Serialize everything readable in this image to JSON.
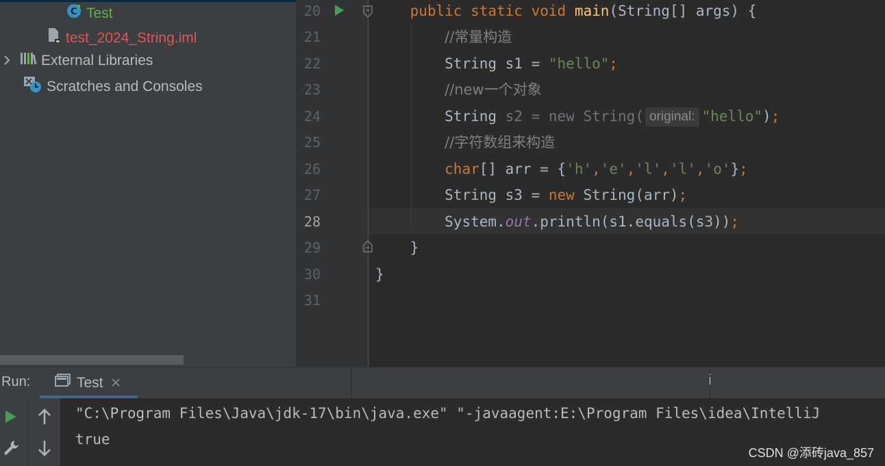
{
  "project_tree": {
    "items": [
      {
        "label": "Test",
        "icon": "java-class-icon",
        "color": "#62b543"
      },
      {
        "label": "test_2024_String.iml",
        "icon": "iml-file-icon",
        "color": "#e05555"
      },
      {
        "label": "External Libraries",
        "icon": "libraries-icon",
        "color": "#bbbbbb"
      },
      {
        "label": "Scratches and Consoles",
        "icon": "scratches-icon",
        "color": "#bbbbbb"
      }
    ]
  },
  "editor": {
    "line_numbers": [
      "20",
      "21",
      "22",
      "23",
      "24",
      "25",
      "26",
      "27",
      "28",
      "29",
      "30",
      "31"
    ],
    "current_line": "28",
    "lines": {
      "l20": {
        "kw1": "public",
        "kw2": "static",
        "kw3": "void",
        "fn": "main",
        "rest": "(String[] args) {"
      },
      "l21": {
        "comment": "//常量构造"
      },
      "l22": {
        "type": "String s1 = ",
        "str": "\"hello\"",
        "semi": ";"
      },
      "l23": {
        "comment": "//new一个对象"
      },
      "l24": {
        "type": "String ",
        "unused": "s2 = new String(",
        "hint": "original:",
        "str": "\"hello\"",
        "close": ")",
        "semi": ";"
      },
      "l25": {
        "comment": "//字符数组来构造"
      },
      "l26": {
        "kw": "char",
        "mid": "[] arr = {",
        "c1": "'h'",
        "c2": "'e'",
        "c3": "'l'",
        "c4": "'l'",
        "c5": "'o'",
        "comma": ",",
        "end": "}",
        "semi": ";"
      },
      "l27": {
        "pre": "String s3 = ",
        "kw": "new",
        "post": " String(arr)",
        "semi": ";"
      },
      "l28": {
        "pre": "System.",
        "field": "out",
        "post": ".println(s1.equals(s3))",
        "semi": ";"
      },
      "l29": {
        "text": "}"
      },
      "l30": {
        "text": "}"
      }
    }
  },
  "run": {
    "label": "Run:",
    "tab": "Test",
    "console": [
      "\"C:\\Program Files\\Java\\jdk-17\\bin\\java.exe\" \"-javaagent:E:\\Program Files\\idea\\IntelliJ",
      "true"
    ]
  },
  "watermark": "CSDN @添砖java_857"
}
